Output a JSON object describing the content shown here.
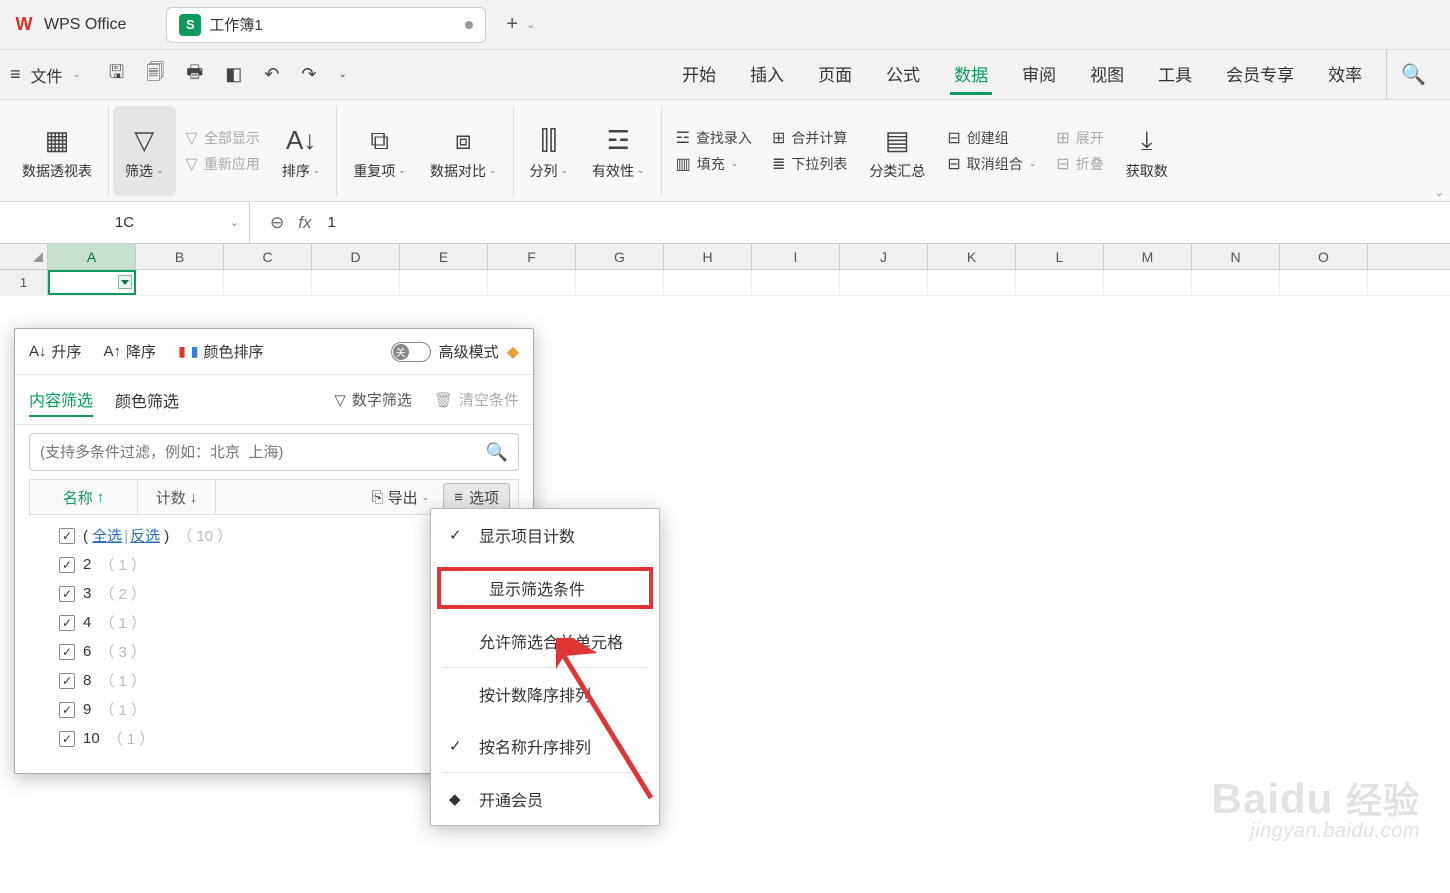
{
  "app": {
    "name": "WPS Office",
    "tab": "工作簿1"
  },
  "menubar": {
    "file": "文件",
    "menus": [
      "开始",
      "插入",
      "页面",
      "公式",
      "数据",
      "审阅",
      "视图",
      "工具",
      "会员专享",
      "效率"
    ],
    "active": "数据"
  },
  "ribbon": {
    "pivot": "数据透视表",
    "filter": "筛选",
    "showall": "全部显示",
    "reapply": "重新应用",
    "sort": "排序",
    "dup": "重复项",
    "compare": "数据对比",
    "split": "分列",
    "validity": "有效性",
    "find": "查找录入",
    "consol": "合并计算",
    "fill": "填充",
    "dropdown": "下拉列表",
    "subtotal": "分类汇总",
    "group": "创建组",
    "ungroup": "取消组合",
    "expand": "展开",
    "collapse": "折叠",
    "fetch": "获取数"
  },
  "fxbar": {
    "name": "1C",
    "fx": "fx",
    "value": "1"
  },
  "columns": [
    "A",
    "B",
    "C",
    "D",
    "E",
    "F",
    "G",
    "H",
    "I",
    "J",
    "K",
    "L",
    "M",
    "N",
    "O"
  ],
  "row1": "1",
  "filterPanel": {
    "asc": "升序",
    "desc": "降序",
    "colorSort": "颜色排序",
    "toggleText": "关",
    "advMode": "高级模式",
    "tabContent": "内容筛选",
    "tabColor": "颜色筛选",
    "numFilter": "数字筛选",
    "clear": "清空条件",
    "searchPlaceholder": "(支持多条件过滤，例如：北京  上海)",
    "hdrName": "名称",
    "hdrCount": "计数",
    "export": "导出",
    "options": "选项",
    "selectAll": "全选",
    "invert": "反选",
    "totalCount": "10",
    "items": [
      {
        "label": "2",
        "count": "1"
      },
      {
        "label": "3",
        "count": "2"
      },
      {
        "label": "4",
        "count": "1"
      },
      {
        "label": "6",
        "count": "3"
      },
      {
        "label": "8",
        "count": "1"
      },
      {
        "label": "9",
        "count": "1"
      },
      {
        "label": "10",
        "count": "1"
      }
    ]
  },
  "optionsMenu": {
    "showCount": "显示项目计数",
    "showCond": "显示筛选条件",
    "allowMerge": "允许筛选合并单元格",
    "sortCountDesc": "按计数降序排列",
    "sortNameAsc": "按名称升序排列",
    "vip": "开通会员"
  },
  "watermark": {
    "brand": "Baidu",
    "brandCn": "经验",
    "url": "jingyan.baidu.com"
  }
}
